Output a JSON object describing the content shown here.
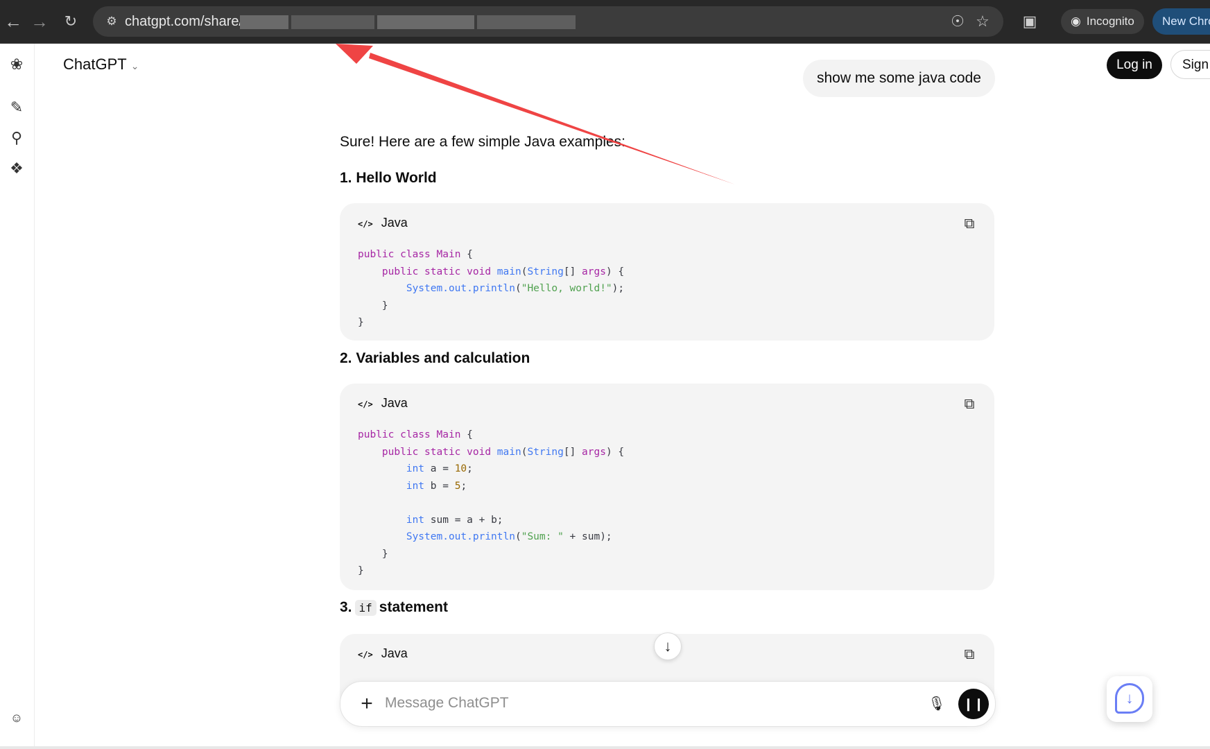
{
  "browser": {
    "url_prefix": "chatgpt.com/share/",
    "incognito_label": "Incognito",
    "new_chrome_label": "New Chrome",
    "icons": {
      "back": "arrow-left-icon",
      "forward": "arrow-right-icon",
      "reload": "reload-icon",
      "site_info": "tune-icon",
      "eye_off": "eye-off-icon",
      "bookmark": "star-icon",
      "extensions": "puzzle-icon",
      "incognito": "incognito-icon"
    }
  },
  "header": {
    "title": "ChatGPT",
    "login_label": "Log in",
    "signup_label": "Sign"
  },
  "sidebar": {
    "icons": [
      "chatgpt-logo-icon",
      "new-chat-icon",
      "search-icon",
      "gpts-icon",
      "profile-icon"
    ]
  },
  "conversation": {
    "user_message": "show me some java code",
    "intro": "Sure! Here are a few simple Java examples:",
    "sections": [
      {
        "heading": "1. Hello World",
        "lang": "Java",
        "lines": [
          [
            {
              "t": "public class ",
              "c": "kw"
            },
            {
              "t": "Main",
              "c": "cls"
            },
            {
              "t": " {",
              "c": ""
            }
          ],
          [
            {
              "t": "    ",
              "c": ""
            },
            {
              "t": "public static void ",
              "c": "kw"
            },
            {
              "t": "main",
              "c": "ty"
            },
            {
              "t": "(",
              "c": ""
            },
            {
              "t": "String",
              "c": "ty"
            },
            {
              "t": "[] ",
              "c": ""
            },
            {
              "t": "args",
              "c": "kw"
            },
            {
              "t": ") {",
              "c": ""
            }
          ],
          [
            {
              "t": "        ",
              "c": ""
            },
            {
              "t": "System.out.println",
              "c": "ty"
            },
            {
              "t": "(",
              "c": ""
            },
            {
              "t": "\"Hello, world!\"",
              "c": "str"
            },
            {
              "t": ");",
              "c": ""
            }
          ],
          [
            {
              "t": "    }",
              "c": ""
            }
          ],
          [
            {
              "t": "}",
              "c": ""
            }
          ]
        ]
      },
      {
        "heading": "2. Variables and calculation",
        "lang": "Java",
        "lines": [
          [
            {
              "t": "public class ",
              "c": "kw"
            },
            {
              "t": "Main",
              "c": "cls"
            },
            {
              "t": " {",
              "c": ""
            }
          ],
          [
            {
              "t": "    ",
              "c": ""
            },
            {
              "t": "public static void ",
              "c": "kw"
            },
            {
              "t": "main",
              "c": "ty"
            },
            {
              "t": "(",
              "c": ""
            },
            {
              "t": "String",
              "c": "ty"
            },
            {
              "t": "[] ",
              "c": ""
            },
            {
              "t": "args",
              "c": "kw"
            },
            {
              "t": ") {",
              "c": ""
            }
          ],
          [
            {
              "t": "        ",
              "c": ""
            },
            {
              "t": "int",
              "c": "ty"
            },
            {
              "t": " a = ",
              "c": ""
            },
            {
              "t": "10",
              "c": "num"
            },
            {
              "t": ";",
              "c": ""
            }
          ],
          [
            {
              "t": "        ",
              "c": ""
            },
            {
              "t": "int",
              "c": "ty"
            },
            {
              "t": " b = ",
              "c": ""
            },
            {
              "t": "5",
              "c": "num"
            },
            {
              "t": ";",
              "c": ""
            }
          ],
          [
            {
              "t": "",
              "c": ""
            }
          ],
          [
            {
              "t": "        ",
              "c": ""
            },
            {
              "t": "int",
              "c": "ty"
            },
            {
              "t": " sum = a + b;",
              "c": ""
            }
          ],
          [
            {
              "t": "        ",
              "c": ""
            },
            {
              "t": "System.out.println",
              "c": "ty"
            },
            {
              "t": "(",
              "c": ""
            },
            {
              "t": "\"Sum: \"",
              "c": "str"
            },
            {
              "t": " + sum);",
              "c": ""
            }
          ],
          [
            {
              "t": "    }",
              "c": ""
            }
          ],
          [
            {
              "t": "}",
              "c": ""
            }
          ]
        ]
      },
      {
        "heading_num": "3.",
        "heading_code": "if",
        "heading_rest": "statement",
        "lang": "Java"
      }
    ]
  },
  "composer": {
    "placeholder": "Message ChatGPT"
  },
  "colors": {
    "chrome_bg": "#282828",
    "annotation_arrow": "#ef4444",
    "keyword": "#a626a4",
    "type": "#4078f2",
    "string": "#50a14f",
    "number": "#986801"
  }
}
